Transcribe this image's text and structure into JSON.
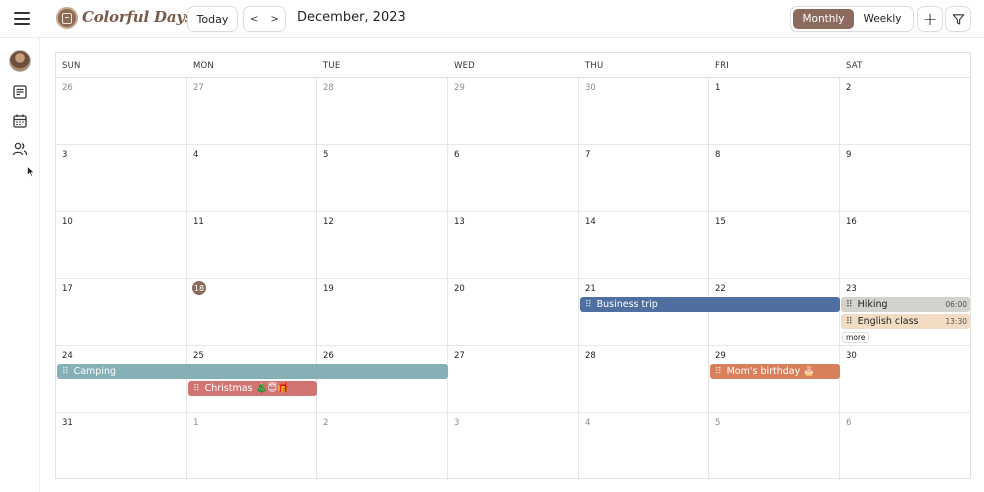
{
  "app": {
    "title": "Colorful Days"
  },
  "toolbar": {
    "today_label": "Today",
    "prev_label": "<",
    "next_label": ">",
    "current_month": "December, 2023",
    "views": [
      "Monthly",
      "Weekly"
    ],
    "active_view": "Monthly",
    "add_label": "+"
  },
  "colors": {
    "accent": "#8c6a5d",
    "event_business": "#4f6fa0",
    "event_hiking": "#d3d2cd",
    "event_english": "#f2dcc4",
    "event_camping": "#84b0b6",
    "event_christmas": "#cf7470",
    "event_birthday": "#d8805c"
  },
  "calendar": {
    "weekdays": [
      "SUN",
      "MON",
      "TUE",
      "WED",
      "THU",
      "FRI",
      "SAT"
    ],
    "today": "18",
    "weeks": [
      [
        {
          "d": "26",
          "other": true
        },
        {
          "d": "27",
          "other": true
        },
        {
          "d": "28",
          "other": true
        },
        {
          "d": "29",
          "other": true
        },
        {
          "d": "30",
          "other": true
        },
        {
          "d": "1",
          "other": false
        },
        {
          "d": "2",
          "other": false
        }
      ],
      [
        {
          "d": "3",
          "other": false
        },
        {
          "d": "4",
          "other": false
        },
        {
          "d": "5",
          "other": false
        },
        {
          "d": "6",
          "other": false
        },
        {
          "d": "7",
          "other": false
        },
        {
          "d": "8",
          "other": false
        },
        {
          "d": "9",
          "other": false
        }
      ],
      [
        {
          "d": "10",
          "other": false
        },
        {
          "d": "11",
          "other": false
        },
        {
          "d": "12",
          "other": false
        },
        {
          "d": "13",
          "other": false
        },
        {
          "d": "14",
          "other": false
        },
        {
          "d": "15",
          "other": false
        },
        {
          "d": "16",
          "other": false
        }
      ],
      [
        {
          "d": "17",
          "other": false
        },
        {
          "d": "18",
          "other": false
        },
        {
          "d": "19",
          "other": false
        },
        {
          "d": "20",
          "other": false
        },
        {
          "d": "21",
          "other": false
        },
        {
          "d": "22",
          "other": false
        },
        {
          "d": "23",
          "other": false
        }
      ],
      [
        {
          "d": "24",
          "other": false
        },
        {
          "d": "25",
          "other": false
        },
        {
          "d": "26",
          "other": false
        },
        {
          "d": "27",
          "other": false
        },
        {
          "d": "28",
          "other": false
        },
        {
          "d": "29",
          "other": false
        },
        {
          "d": "30",
          "other": false
        }
      ],
      [
        {
          "d": "31",
          "other": false
        },
        {
          "d": "1",
          "other": true
        },
        {
          "d": "2",
          "other": true
        },
        {
          "d": "3",
          "other": true
        },
        {
          "d": "4",
          "other": true
        },
        {
          "d": "5",
          "other": true
        },
        {
          "d": "6",
          "other": true
        }
      ]
    ],
    "events": {
      "business_trip": {
        "title": "Business trip"
      },
      "hiking": {
        "title": "Hiking",
        "time": "06:00"
      },
      "english_class": {
        "title": "English class",
        "time": "13:30"
      },
      "more": "more",
      "camping": {
        "title": "Camping"
      },
      "christmas": {
        "title": "Christmas 🎄😇🎁"
      },
      "moms_birthday": {
        "title": "Mom's birthday 🎂"
      }
    }
  },
  "sidebar": {
    "items": [
      {
        "icon": "avatar"
      },
      {
        "icon": "notes-icon"
      },
      {
        "icon": "calendar-icon"
      },
      {
        "icon": "users-icon"
      }
    ]
  }
}
